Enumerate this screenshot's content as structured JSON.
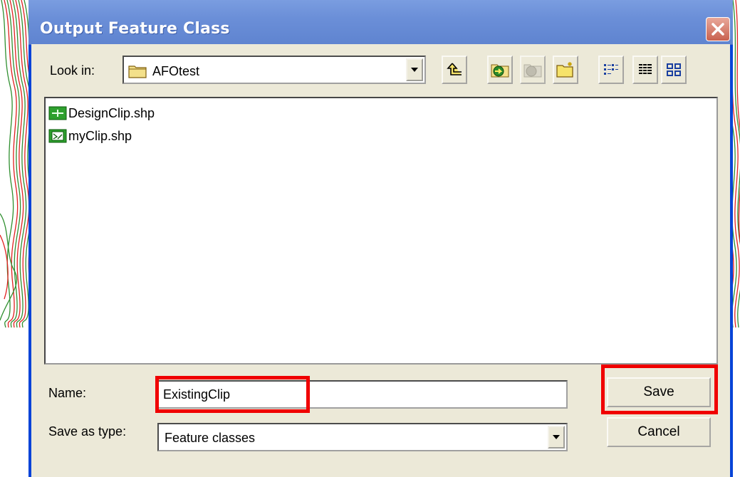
{
  "dialog": {
    "title": "Output Feature Class",
    "close_icon": "close-x-icon"
  },
  "lookin": {
    "label": "Look in:",
    "value": "AFOtest",
    "icon": "folder-icon"
  },
  "toolbar": {
    "icons": [
      "up-one-level-icon",
      "connect-folder-icon",
      "disconnect-folder-icon",
      "new-folder-icon",
      "list-view-icon",
      "details-view-icon",
      "thumbnails-view-icon"
    ]
  },
  "files": [
    {
      "name": "DesignClip.shp",
      "icon": "line-feature-class-icon"
    },
    {
      "name": "myClip.shp",
      "icon": "polygon-feature-class-icon"
    }
  ],
  "name_field": {
    "label": "Name:",
    "value": "ExistingClip"
  },
  "type_field": {
    "label": "Save as type:",
    "value": "Feature classes"
  },
  "buttons": {
    "save": "Save",
    "cancel": "Cancel"
  },
  "colors": {
    "highlight": "#f00000",
    "titlebar": "#6b8fd8",
    "dialog_face": "#ece9d8"
  }
}
